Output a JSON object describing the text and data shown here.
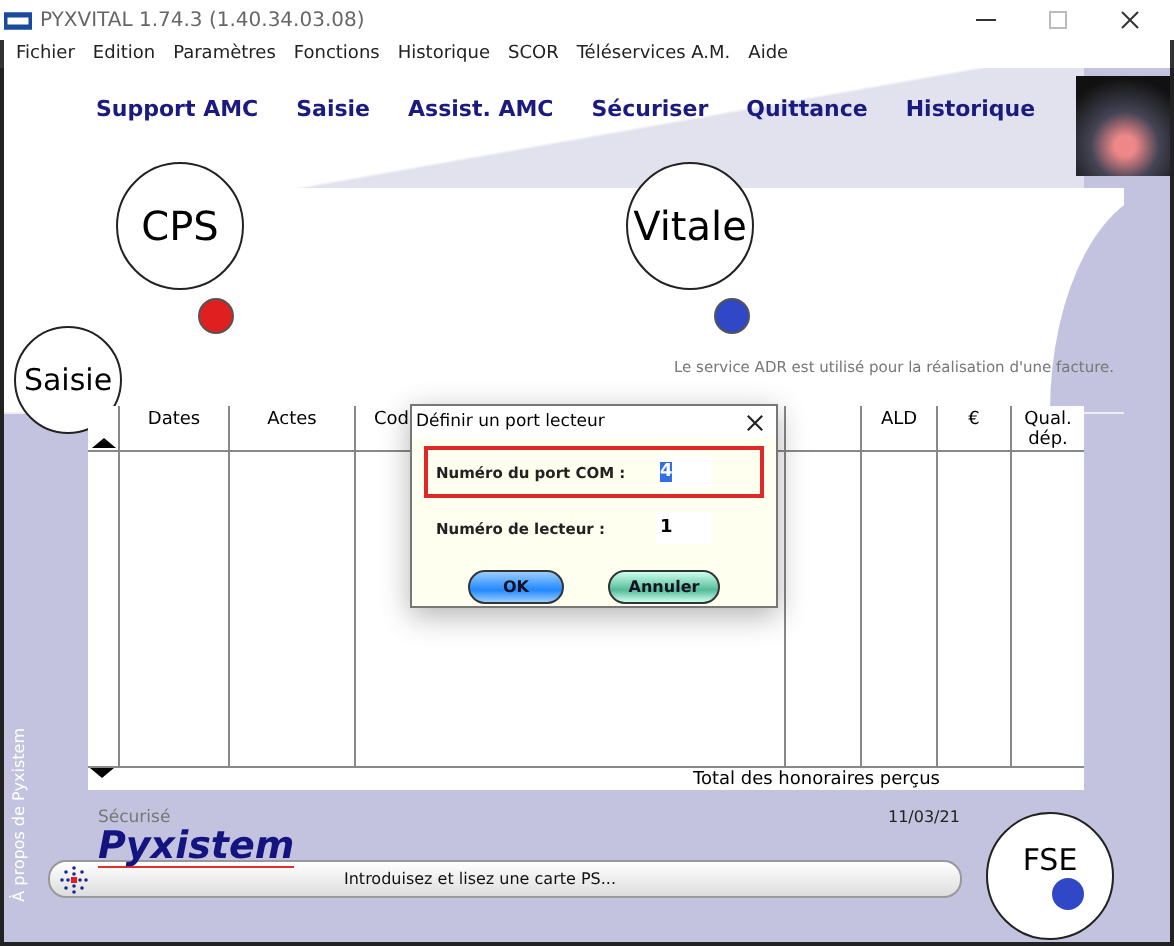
{
  "window": {
    "title": "PYXVITAL 1.74.3 (1.40.34.03.08)"
  },
  "menu": [
    "Fichier",
    "Edition",
    "Paramètres",
    "Fonctions",
    "Historique",
    "SCOR",
    "Téléservices A.M.",
    "Aide"
  ],
  "nav_tabs": [
    "Support AMC",
    "Saisie",
    "Assist. AMC",
    "Sécuriser",
    "Quittance",
    "Historique"
  ],
  "cards": [
    {
      "label": "CPS",
      "color": "#e02020"
    },
    {
      "label": "Vitale",
      "color": "#3048c8"
    }
  ],
  "saisie_badge": "Saisie",
  "notice": "Le service ADR est utilisé pour la réalisation d'une facture.",
  "table": {
    "columns": [
      {
        "label": "Dates"
      },
      {
        "label": "Actes"
      },
      {
        "label": "Cod"
      },
      {},
      {
        "label": "ALD"
      },
      {
        "label": "€"
      },
      {
        "label": "Qual. dép."
      }
    ],
    "total_label": "Total des honoraires perçus"
  },
  "dialog": {
    "title": "Définir un port lecteur",
    "fields": [
      {
        "label": "Numéro du port COM :",
        "value": "4",
        "selected": true,
        "highlighted": true
      },
      {
        "label": "Numéro de lecteur :",
        "value": "1",
        "selected": false,
        "highlighted": false
      }
    ],
    "buttons": [
      {
        "label": "OK",
        "kind": "primary"
      },
      {
        "label": "Annuler",
        "kind": "secondary"
      }
    ]
  },
  "status_label": "Sécurisé",
  "date": "11/03/21",
  "brand": "Pyxistem",
  "status_message": "Introduisez et lisez une carte PS...",
  "side_link": "À propos de Pyxistem",
  "fse": {
    "label": "FSE",
    "color": "#3048c8"
  }
}
